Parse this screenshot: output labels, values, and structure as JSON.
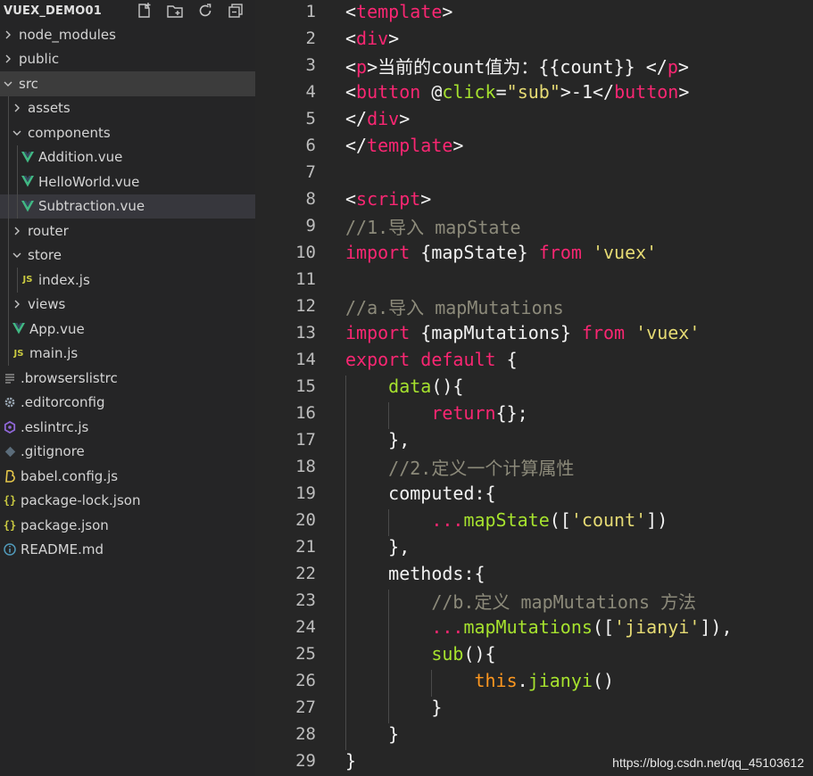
{
  "explorer": {
    "title": "VUEX_DEMO01",
    "actions": [
      "new-file-icon",
      "new-folder-icon",
      "refresh-icon",
      "collapse-all-icon"
    ],
    "items": [
      {
        "label": "node_modules",
        "kind": "folder",
        "open": false,
        "depth": 0
      },
      {
        "label": "public",
        "kind": "folder",
        "open": false,
        "depth": 0
      },
      {
        "label": "src",
        "kind": "folder",
        "open": true,
        "depth": 0,
        "state": "active"
      },
      {
        "label": "assets",
        "kind": "folder",
        "open": false,
        "depth": 1
      },
      {
        "label": "components",
        "kind": "folder",
        "open": true,
        "depth": 1
      },
      {
        "label": "Addition.vue",
        "kind": "vue",
        "depth": 2
      },
      {
        "label": "HelloWorld.vue",
        "kind": "vue",
        "depth": 2
      },
      {
        "label": "Subtraction.vue",
        "kind": "vue",
        "depth": 2,
        "state": "selected"
      },
      {
        "label": "router",
        "kind": "folder",
        "open": false,
        "depth": 1
      },
      {
        "label": "store",
        "kind": "folder",
        "open": true,
        "depth": 1
      },
      {
        "label": "index.js",
        "kind": "js",
        "depth": 2
      },
      {
        "label": "views",
        "kind": "folder",
        "open": false,
        "depth": 1
      },
      {
        "label": "App.vue",
        "kind": "vue",
        "depth": 1
      },
      {
        "label": "main.js",
        "kind": "js",
        "depth": 1
      },
      {
        "label": ".browserslistrc",
        "kind": "lines",
        "depth": 0
      },
      {
        "label": ".editorconfig",
        "kind": "gear",
        "depth": 0
      },
      {
        "label": ".eslintrc.js",
        "kind": "eslint",
        "depth": 0
      },
      {
        "label": ".gitignore",
        "kind": "git",
        "depth": 0
      },
      {
        "label": "babel.config.js",
        "kind": "babel",
        "depth": 0
      },
      {
        "label": "package-lock.json",
        "kind": "json",
        "depth": 0
      },
      {
        "label": "package.json",
        "kind": "json",
        "depth": 0
      },
      {
        "label": "README.md",
        "kind": "info",
        "depth": 0
      }
    ]
  },
  "colors": {
    "vue": "#41b883",
    "js": "#cbcb41",
    "tag": "#f92672",
    "function": "#a6e22e",
    "string": "#e6db74",
    "comment": "#8c8a7a",
    "this": "#fd971f"
  },
  "editor": {
    "lines": [
      {
        "n": "1",
        "indent": 0,
        "tokens": [
          [
            "p",
            "<"
          ],
          [
            "tag",
            "template"
          ],
          [
            "p",
            ">"
          ]
        ]
      },
      {
        "n": "2",
        "indent": 0,
        "tokens": [
          [
            "p",
            "<"
          ],
          [
            "tag",
            "div"
          ],
          [
            "p",
            ">"
          ]
        ]
      },
      {
        "n": "3",
        "indent": 0,
        "tokens": [
          [
            "p",
            "<"
          ],
          [
            "tag",
            "p"
          ],
          [
            "p",
            ">当前的count值为：{{count}} </"
          ],
          [
            "tag",
            "p"
          ],
          [
            "p",
            ">"
          ]
        ]
      },
      {
        "n": "4",
        "indent": 0,
        "tokens": [
          [
            "p",
            "<"
          ],
          [
            "tag",
            "button"
          ],
          [
            "p",
            " @"
          ],
          [
            "attr",
            "click"
          ],
          [
            "p",
            "="
          ],
          [
            "str",
            "\"sub\""
          ],
          [
            "p",
            ">-1</"
          ],
          [
            "tag",
            "button"
          ],
          [
            "p",
            ">"
          ]
        ]
      },
      {
        "n": "5",
        "indent": 0,
        "tokens": [
          [
            "p",
            "</"
          ],
          [
            "tag",
            "div"
          ],
          [
            "p",
            ">"
          ]
        ]
      },
      {
        "n": "6",
        "indent": 0,
        "tokens": [
          [
            "p",
            "</"
          ],
          [
            "tag",
            "template"
          ],
          [
            "p",
            ">"
          ]
        ]
      },
      {
        "n": "7",
        "indent": 0,
        "tokens": []
      },
      {
        "n": "8",
        "indent": 0,
        "tokens": [
          [
            "p",
            "<"
          ],
          [
            "tag",
            "script"
          ],
          [
            "p",
            ">"
          ]
        ]
      },
      {
        "n": "9",
        "indent": 0,
        "tokens": [
          [
            "com",
            "//1.导入 mapState"
          ]
        ]
      },
      {
        "n": "10",
        "indent": 0,
        "tokens": [
          [
            "kw",
            "import"
          ],
          [
            "p",
            " {mapState} "
          ],
          [
            "kw",
            "from"
          ],
          [
            "p",
            " "
          ],
          [
            "str",
            "'vuex'"
          ]
        ]
      },
      {
        "n": "11",
        "indent": 0,
        "tokens": []
      },
      {
        "n": "12",
        "indent": 0,
        "tokens": [
          [
            "com",
            "//a.导入 mapMutations"
          ]
        ]
      },
      {
        "n": "13",
        "indent": 0,
        "tokens": [
          [
            "kw",
            "import"
          ],
          [
            "p",
            " {mapMutations} "
          ],
          [
            "kw",
            "from"
          ],
          [
            "p",
            " "
          ],
          [
            "str",
            "'vuex'"
          ]
        ]
      },
      {
        "n": "14",
        "indent": 0,
        "tokens": [
          [
            "kw",
            "export"
          ],
          [
            "p",
            " "
          ],
          [
            "kw",
            "default"
          ],
          [
            "p",
            " {"
          ]
        ]
      },
      {
        "n": "15",
        "indent": 1,
        "tokens": [
          [
            "fn",
            "data"
          ],
          [
            "p",
            "(){"
          ]
        ]
      },
      {
        "n": "16",
        "indent": 2,
        "tokens": [
          [
            "kw",
            "return"
          ],
          [
            "p",
            "{};"
          ]
        ]
      },
      {
        "n": "17",
        "indent": 1,
        "tokens": [
          [
            "p",
            "},"
          ]
        ]
      },
      {
        "n": "18",
        "indent": 1,
        "tokens": [
          [
            "com",
            "//2.定义一个计算属性"
          ]
        ]
      },
      {
        "n": "19",
        "indent": 1,
        "tokens": [
          [
            "p",
            "computed:{"
          ]
        ]
      },
      {
        "n": "20",
        "indent": 2,
        "tokens": [
          [
            "kw",
            "..."
          ],
          [
            "fn",
            "mapState"
          ],
          [
            "p",
            "(["
          ],
          [
            "str",
            "'count'"
          ],
          [
            "p",
            "])"
          ]
        ]
      },
      {
        "n": "21",
        "indent": 1,
        "tokens": [
          [
            "p",
            "},"
          ]
        ]
      },
      {
        "n": "22",
        "indent": 1,
        "tokens": [
          [
            "p",
            "methods:{"
          ]
        ]
      },
      {
        "n": "23",
        "indent": 2,
        "tokens": [
          [
            "com",
            "//b.定义 mapMutations 方法"
          ]
        ]
      },
      {
        "n": "24",
        "indent": 2,
        "tokens": [
          [
            "kw",
            "..."
          ],
          [
            "fn",
            "mapMutations"
          ],
          [
            "p",
            "(["
          ],
          [
            "str",
            "'jianyi'"
          ],
          [
            "p",
            "]),"
          ]
        ]
      },
      {
        "n": "25",
        "indent": 2,
        "tokens": [
          [
            "fn",
            "sub"
          ],
          [
            "p",
            "(){"
          ]
        ]
      },
      {
        "n": "26",
        "indent": 3,
        "tokens": [
          [
            "this",
            "this"
          ],
          [
            "p",
            "."
          ],
          [
            "fn",
            "jianyi"
          ],
          [
            "p",
            "()"
          ]
        ]
      },
      {
        "n": "27",
        "indent": 2,
        "tokens": [
          [
            "p",
            "}"
          ]
        ]
      },
      {
        "n": "28",
        "indent": 1,
        "tokens": [
          [
            "p",
            "}"
          ]
        ]
      },
      {
        "n": "29",
        "indent": 0,
        "tokens": [
          [
            "p",
            "}"
          ]
        ]
      }
    ]
  },
  "watermark": "https://blog.csdn.net/qq_45103612"
}
